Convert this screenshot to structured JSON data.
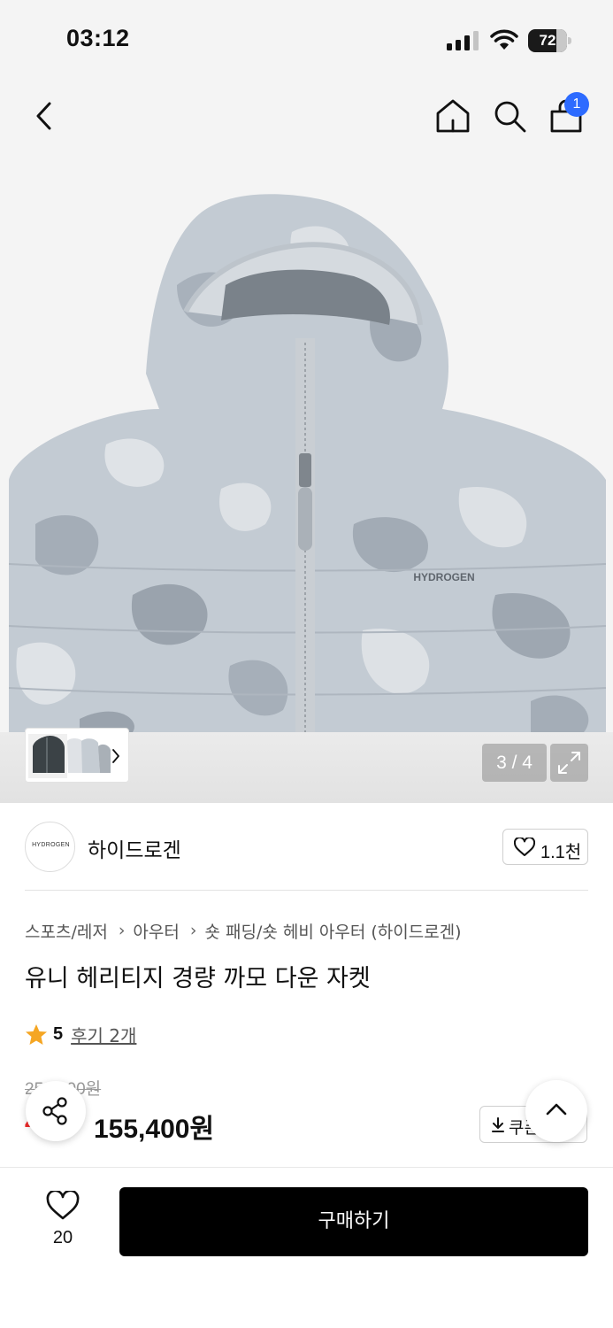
{
  "status_bar": {
    "time": "03:12",
    "battery": "72",
    "battery_level_percent": 72
  },
  "header": {
    "cart_count": "1",
    "icons": [
      "back-icon",
      "home-icon",
      "search-icon",
      "bag-icon"
    ]
  },
  "gallery": {
    "counter": "3 / 4",
    "jacket_logo": "HYDROGEN",
    "icons": [
      "chevron-right-icon",
      "expand-icon"
    ]
  },
  "brand": {
    "logo_text": "HYDROGEN",
    "name": "하이드로겐",
    "likes": "1.1천"
  },
  "product": {
    "breadcrumb": [
      "스포츠/레저",
      "아우터",
      "숏 패딩/숏 헤비 아우터 (하이드로겐)"
    ],
    "title": "유니 헤리티지 경량 까모 다운 자켓",
    "rating": "5",
    "reviews": "후기 2개",
    "original_price": "259,000원",
    "discount": "40%",
    "sale_price": "155,400원",
    "coupon_label": "쿠폰"
  },
  "bottom_bar": {
    "wish_count": "20",
    "buy_label": "구매하기"
  },
  "colors": {
    "accent_blue": "#2d6bff",
    "discount_red": "#ee2a2a",
    "star": "#f5a623",
    "buy_button": "#000000"
  }
}
